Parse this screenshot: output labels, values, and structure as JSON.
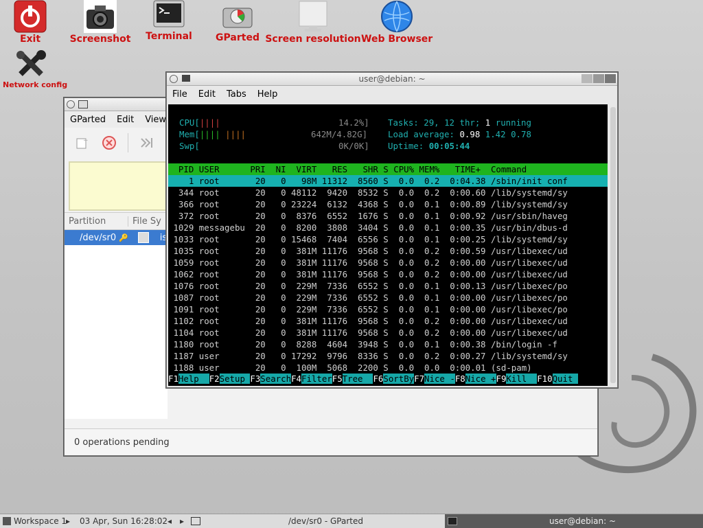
{
  "desktop": {
    "icons": [
      {
        "label": "Exit",
        "icon": "power-icon"
      },
      {
        "label": "Screenshot",
        "icon": "camera-icon"
      },
      {
        "label": "Terminal",
        "icon": "terminal-icon"
      },
      {
        "label": "GParted",
        "icon": "disk-icon"
      },
      {
        "label": "Screen resolution",
        "icon": "monitor-icon"
      },
      {
        "label": "Web Browser",
        "icon": "globe-icon"
      },
      {
        "label": "Network config",
        "icon": "tools-icon"
      }
    ]
  },
  "gparted": {
    "menu": [
      "GParted",
      "Edit",
      "View"
    ],
    "columns": [
      "Partition",
      "File Sy"
    ],
    "row": {
      "partition": "/dev/sr0",
      "fs": "is"
    },
    "status": "0 operations pending"
  },
  "terminal": {
    "title": "user@debian: ~",
    "menu": [
      "File",
      "Edit",
      "Tabs",
      "Help"
    ],
    "meters": {
      "cpu_label": "CPU[",
      "cpu_bar": "||||",
      "cpu_value": "14.2%]",
      "mem_label": "Mem[",
      "mem_bar_a": "||||",
      "mem_bar_b": "||||",
      "mem_value": "642M/4.82G]",
      "swp_label": "Swp[",
      "swp_value": "0K/0K]"
    },
    "summary": {
      "tasks_label": "Tasks:",
      "tasks": "29,",
      "thr": "12",
      "thr_label": "thr;",
      "running": "1",
      "running_label": "running",
      "load_label": "Load average:",
      "load1": "0.98",
      "load5": "1.42",
      "load15": "0.78",
      "uptime_label": "Uptime:",
      "uptime": "00:05:44"
    },
    "header": "  PID USER      PRI  NI  VIRT   RES   SHR S CPU% MEM%   TIME+  Command",
    "rows": [
      "    1 root       20   0   98M 11312  8560 S  0.0  0.2  0:04.38 /sbin/init conf",
      "  344 root       20   0 48112  9420  8532 S  0.0  0.2  0:00.60 /lib/systemd/sy",
      "  366 root       20   0 23224  6132  4368 S  0.0  0.1  0:00.89 /lib/systemd/sy",
      "  372 root       20   0  8376  6552  1676 S  0.0  0.1  0:00.92 /usr/sbin/haveg",
      " 1029 messagebu  20   0  8200  3808  3404 S  0.0  0.1  0:00.35 /usr/bin/dbus-d",
      " 1033 root       20   0 15468  7404  6556 S  0.0  0.1  0:00.25 /lib/systemd/sy",
      " 1035 root       20   0  381M 11176  9568 S  0.0  0.2  0:00.59 /usr/libexec/ud",
      " 1059 root       20   0  381M 11176  9568 S  0.0  0.2  0:00.00 /usr/libexec/ud",
      " 1062 root       20   0  381M 11176  9568 S  0.0  0.2  0:00.00 /usr/libexec/ud",
      " 1076 root       20   0  229M  7336  6552 S  0.0  0.1  0:00.13 /usr/libexec/po",
      " 1087 root       20   0  229M  7336  6552 S  0.0  0.1  0:00.00 /usr/libexec/po",
      " 1091 root       20   0  229M  7336  6552 S  0.0  0.1  0:00.00 /usr/libexec/po",
      " 1102 root       20   0  381M 11176  9568 S  0.0  0.2  0:00.00 /usr/libexec/ud",
      " 1104 root       20   0  381M 11176  9568 S  0.0  0.2  0:00.00 /usr/libexec/ud",
      " 1180 root       20   0  8288  4604  3948 S  0.0  0.1  0:00.38 /bin/login -f",
      " 1187 user       20   0 17292  9796  8336 S  0.0  0.2  0:00.27 /lib/systemd/sy",
      " 1188 user       20   0  100M  5068  2200 S  0.0  0.0  0:00.01 (sd-pam)"
    ],
    "fkeys": [
      {
        "key": "F1",
        "label": "Help  "
      },
      {
        "key": "F2",
        "label": "Setup "
      },
      {
        "key": "F3",
        "label": "Search"
      },
      {
        "key": "F4",
        "label": "Filter"
      },
      {
        "key": "F5",
        "label": "Tree  "
      },
      {
        "key": "F6",
        "label": "SortBy"
      },
      {
        "key": "F7",
        "label": "Nice -"
      },
      {
        "key": "F8",
        "label": "Nice +"
      },
      {
        "key": "F9",
        "label": "Kill  "
      },
      {
        "key": "F10",
        "label": "Quit "
      }
    ]
  },
  "taskbar": {
    "workspace": "Workspace 1",
    "datetime": "03 Apr, Sun 16:28:02",
    "task1": "/dev/sr0 - GParted",
    "task2": "user@debian: ~"
  }
}
